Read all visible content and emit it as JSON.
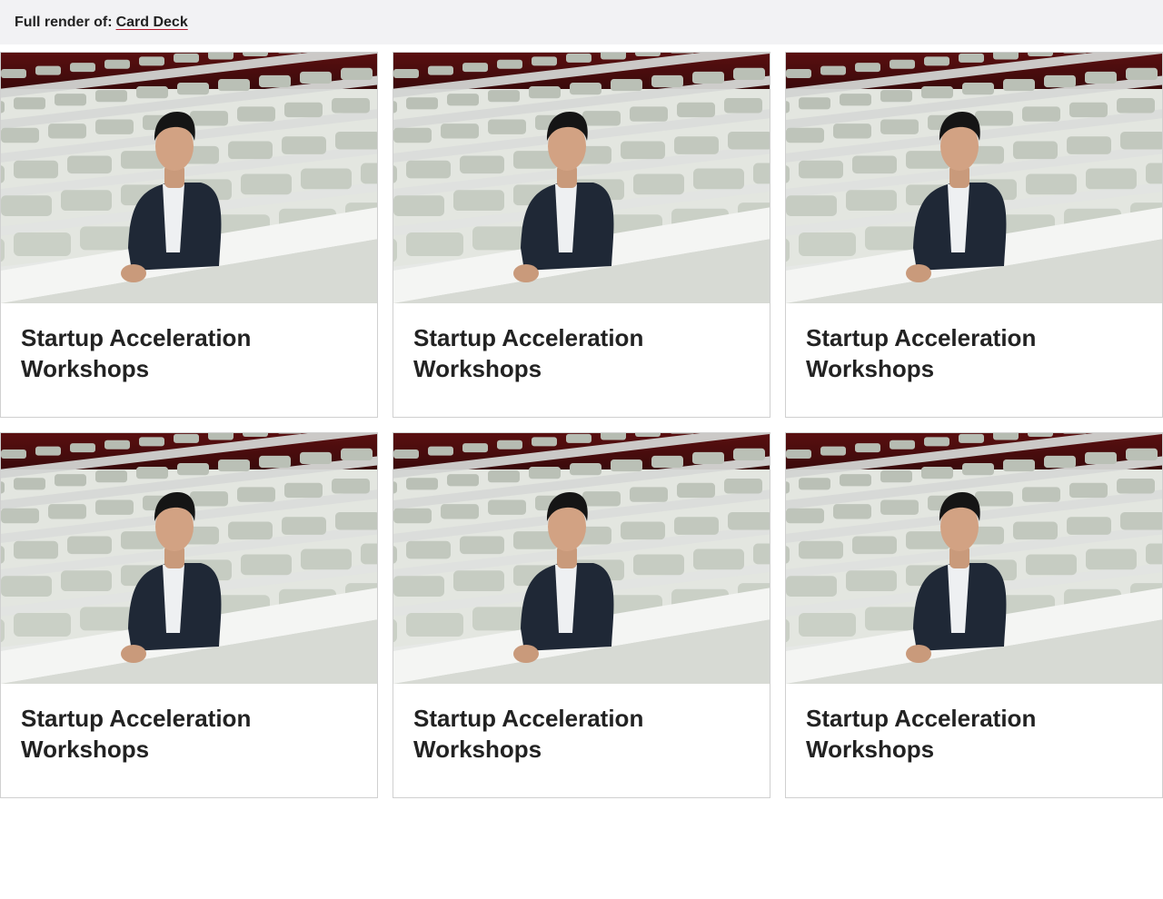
{
  "header": {
    "prefix": "Full render of:",
    "link_label": "Card Deck"
  },
  "cards": [
    {
      "title": "Startup Acceleration Workshops",
      "image": "portrait-lecture-hall-photo"
    },
    {
      "title": "Startup Acceleration Workshops",
      "image": "portrait-lecture-hall-photo"
    },
    {
      "title": "Startup Acceleration Workshops",
      "image": "portrait-lecture-hall-photo"
    },
    {
      "title": "Startup Acceleration Workshops",
      "image": "portrait-lecture-hall-photo"
    },
    {
      "title": "Startup Acceleration Workshops",
      "image": "portrait-lecture-hall-photo"
    },
    {
      "title": "Startup Acceleration Workshops",
      "image": "portrait-lecture-hall-photo"
    }
  ],
  "colors": {
    "link_underline": "#b1152b",
    "header_bg": "#f2f2f4",
    "card_border": "#d0d0d0",
    "curtain": "#5a0f10"
  }
}
